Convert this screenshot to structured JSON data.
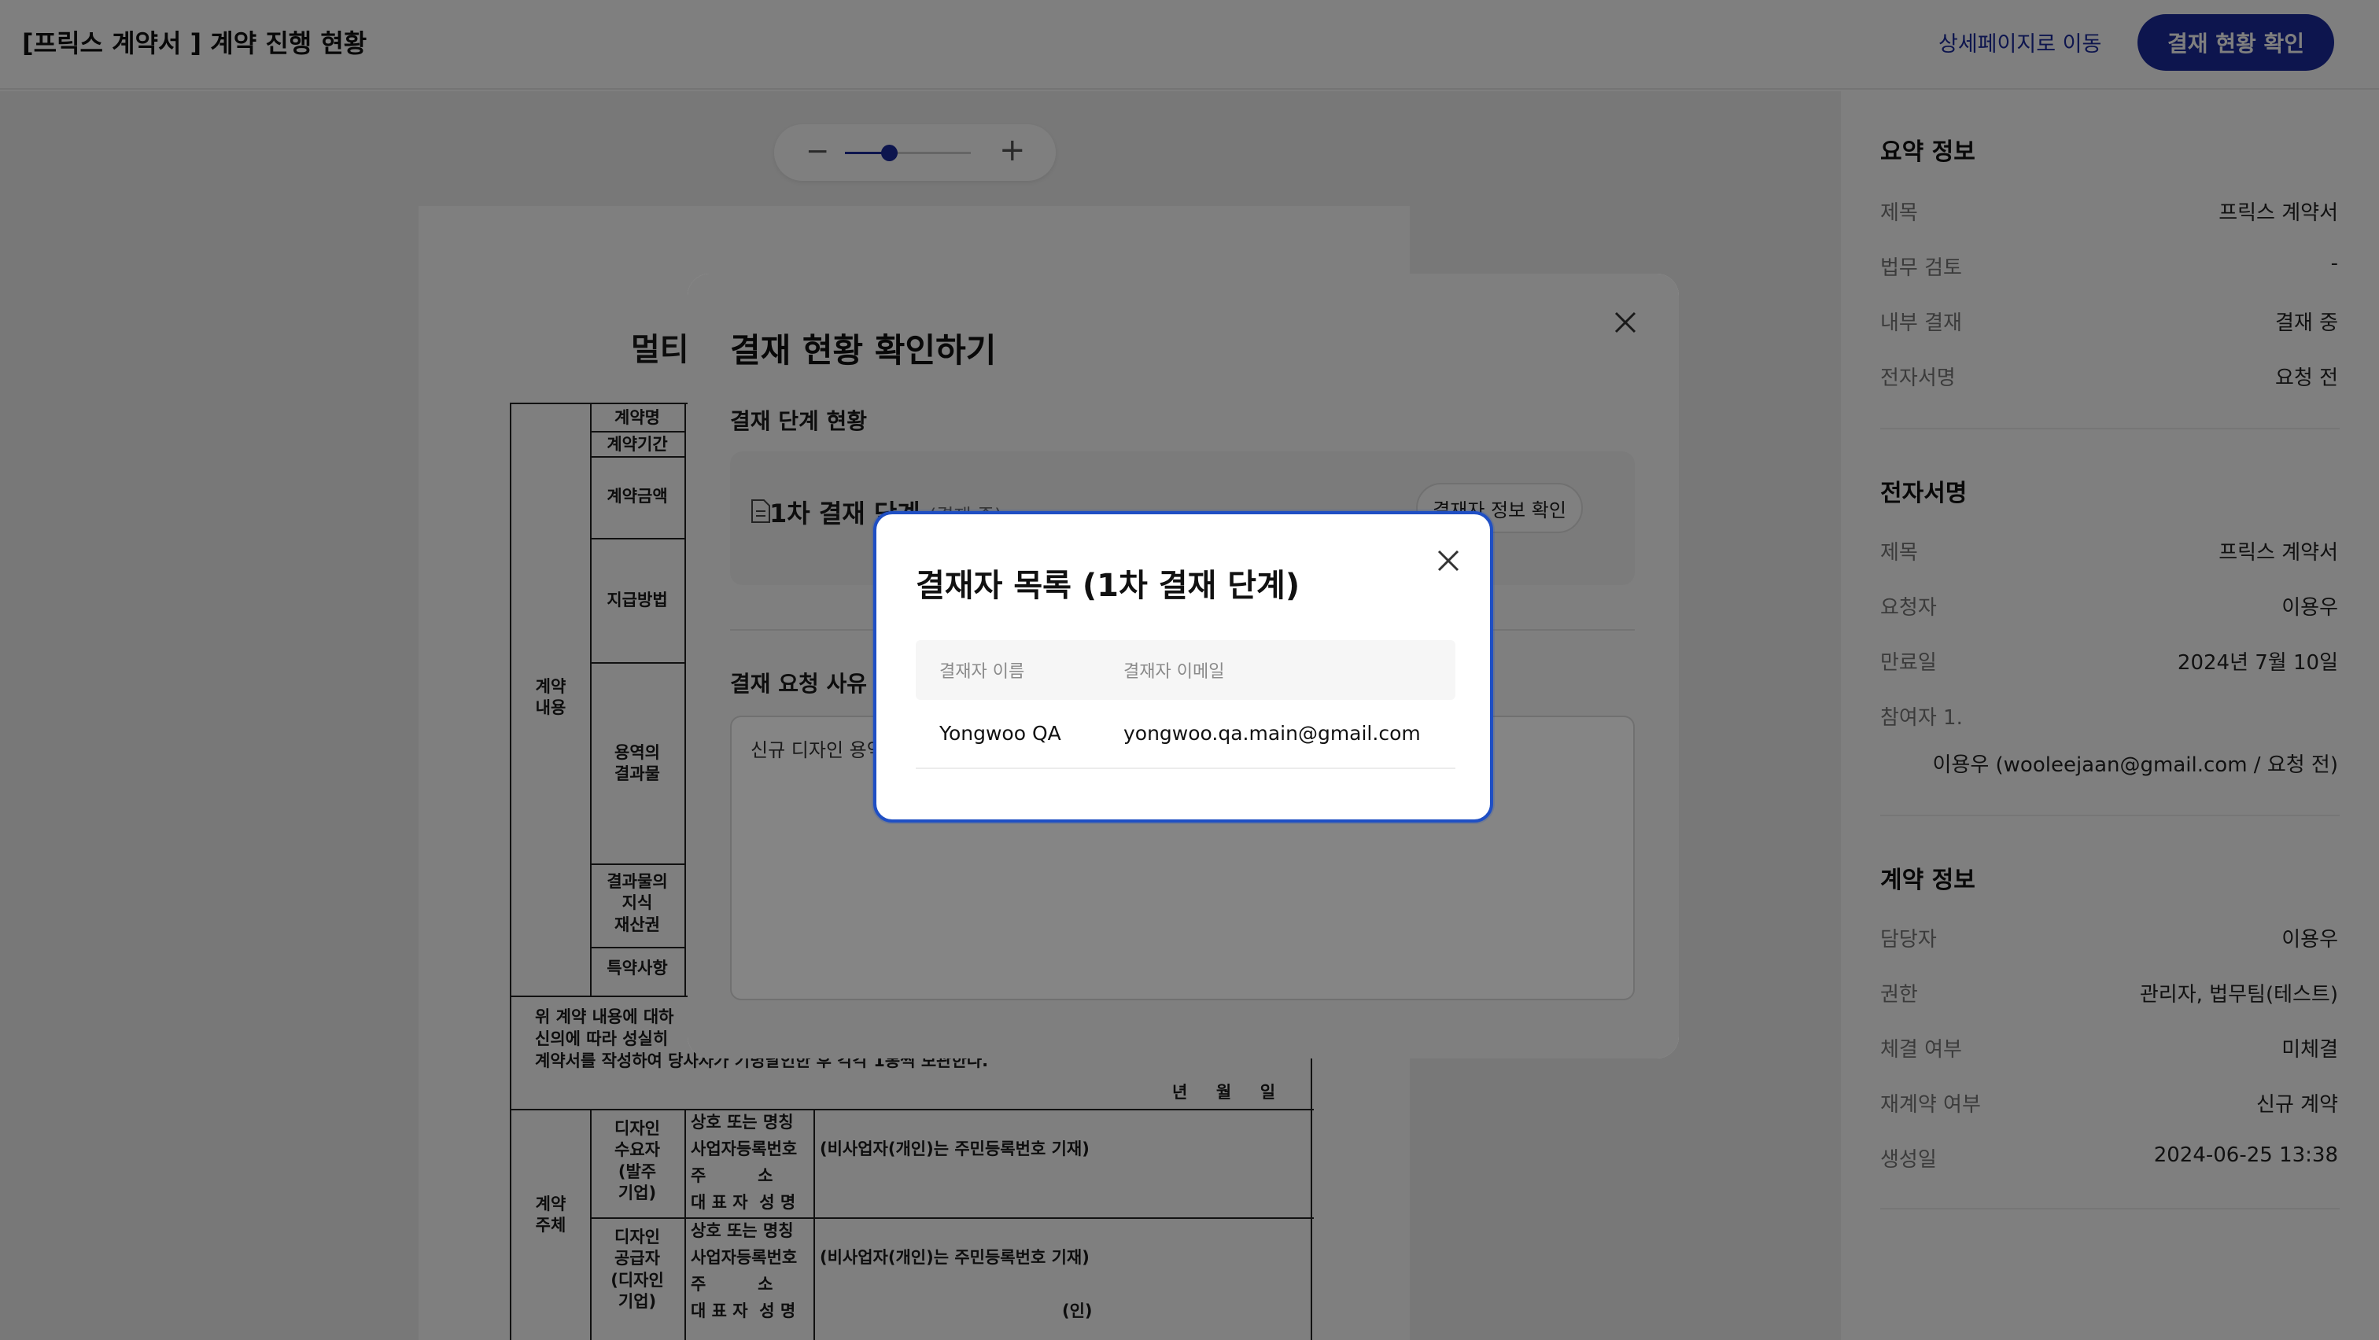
{
  "header": {
    "title": "[프릭스 계약서 ] 계약 진행 현황",
    "detail_link": "상세페이지로 이동",
    "approval_button": "결재 현황 확인"
  },
  "viewer": {
    "zoom_value": 0.35,
    "document": {
      "title": "멀티",
      "labels": {
        "contract_name": "계약명",
        "contract_period": "계약기간",
        "contract_amount": "계약금액",
        "payment_method": "지급방법",
        "contract_content": "계약\n내용",
        "service_result": "용역의\n결과물",
        "ip_rights": "결과물의\n지식\n재산권",
        "special_terms": "특약사항",
        "agreement_1": "위 계약 내용에 대하",
        "agreement_2": "신의에 따라 성실히",
        "agreement_3": "계약서를 작성하여 당사자가 기명날인한 후 각각 1통씩 보관한다.",
        "date": "년     월     일",
        "contract_party": "계약\n주체",
        "designer_client": "디자인\n수요자\n(발주\n기업)",
        "designer_supplier": "디자인\n공급자\n(디자인\n기업)",
        "company_name": "상호 또는 명칭",
        "business_number": "사업자등록번호",
        "address": "주         소",
        "representative": "대 표 자  성 명",
        "individual_note": "(비사업자(개인)는 주민등록번호 기재)",
        "seal": "(인)"
      }
    }
  },
  "sidebar": {
    "summary": {
      "title": "요약 정보",
      "rows": [
        {
          "label": "제목",
          "value": "프릭스 계약서"
        },
        {
          "label": "법무 검토",
          "value": "-"
        },
        {
          "label": "내부 결재",
          "value": "결재 중"
        },
        {
          "label": "전자서명",
          "value": "요청 전"
        }
      ]
    },
    "esign": {
      "title": "전자서명",
      "rows": [
        {
          "label": "제목",
          "value": "프릭스 계약서"
        },
        {
          "label": "요청자",
          "value": "이용우"
        },
        {
          "label": "만료일",
          "value": "2024년 7월 10일"
        }
      ],
      "participant_label": "참여자 1.",
      "participant_value": "이용우 (wooleejaan@gmail.com / 요청 전)"
    },
    "contract": {
      "title": "계약 정보",
      "rows": [
        {
          "label": "담당자",
          "value": "이용우"
        },
        {
          "label": "권한",
          "value": "관리자, 법무팀(테스트)"
        },
        {
          "label": "체결 여부",
          "value": "미체결"
        },
        {
          "label": "재계약 여부",
          "value": "신규 계약"
        },
        {
          "label": "생성일",
          "value": "2024-06-25 13:38"
        }
      ]
    }
  },
  "modal_approval": {
    "title": "결재 현황 확인하기",
    "stage_section_title": "결재 단계 현황",
    "stage_name": "1차 결재 단계",
    "stage_status": "(결재 중)",
    "approver_info_button": "결재자 정보 확인",
    "reason_title": "결재 요청 사유",
    "reason_text": "신규 디자인 용역 계약서입니다. 검토 후 결재해 주시기 바랍니다."
  },
  "modal_approvers": {
    "title": "결재자 목록 (1차 결재 단계)",
    "columns": [
      "결재자 이름",
      "결재자 이메일"
    ],
    "rows": [
      {
        "name": "Yongwoo QA",
        "email": "yongwoo.qa.main@gmail.com"
      }
    ]
  },
  "colors": {
    "primary": "#1b2a9c",
    "focus_border": "#1f4fc4"
  }
}
